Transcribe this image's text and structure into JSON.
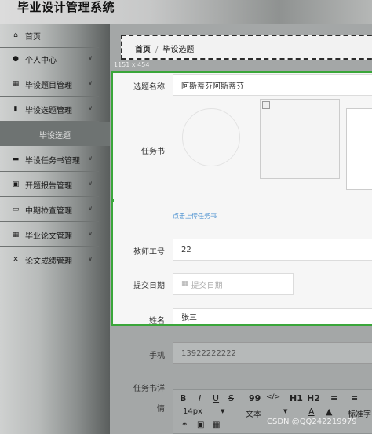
{
  "app": {
    "title": "毕业设计管理系统"
  },
  "sidebar": {
    "items": [
      {
        "label": "首页",
        "icon": "home-icon",
        "glyph": "⌂",
        "expandable": false
      },
      {
        "label": "个人中心",
        "icon": "user-icon",
        "glyph": "●",
        "expandable": true
      },
      {
        "label": "毕设题目管理",
        "icon": "grid-icon",
        "glyph": "▦",
        "expandable": true
      },
      {
        "label": "毕设选题管理",
        "icon": "chart-icon",
        "glyph": "▮",
        "expandable": true
      },
      {
        "label": "毕设任务书管理",
        "icon": "comment-icon",
        "glyph": "▬",
        "expandable": true
      },
      {
        "label": "开题报告管理",
        "icon": "clipboard-icon",
        "glyph": "▣",
        "expandable": true
      },
      {
        "label": "中期检查管理",
        "icon": "monitor-icon",
        "glyph": "▭",
        "expandable": true
      },
      {
        "label": "毕业论文管理",
        "icon": "grid-icon",
        "glyph": "▦",
        "expandable": true
      },
      {
        "label": "论文成绩管理",
        "icon": "briefcase-icon",
        "glyph": "✕",
        "expandable": true
      }
    ],
    "active_sub": "毕设选题"
  },
  "breadcrumb": {
    "home": "首页",
    "separator": "/",
    "current": "毕设选题"
  },
  "selection_size": "1151 x 454",
  "form": {
    "topic_label": "选题名称",
    "topic_value": "阿斯蒂芬阿斯蒂芬",
    "task_label": "任务书",
    "upload_link": "点击上传任务书",
    "teacher_id_label": "教师工号",
    "teacher_id_value": "22",
    "submit_date_label": "提交日期",
    "submit_date_placeholder": "提交日期",
    "name_label": "姓名",
    "name_value": "张三",
    "phone_label": "手机",
    "phone_value": "13922222222",
    "task_detail_label_1": "任务书详",
    "task_detail_label_2": "情"
  },
  "editor": {
    "row1": [
      "B",
      "I",
      "U",
      "S",
      "99",
      "</>",
      "H1",
      "H2",
      "≡",
      "≡"
    ],
    "font_size": "14px",
    "text_style": "文本",
    "font_family": "标准字"
  },
  "watermark": "CSDN @QQ242219979"
}
